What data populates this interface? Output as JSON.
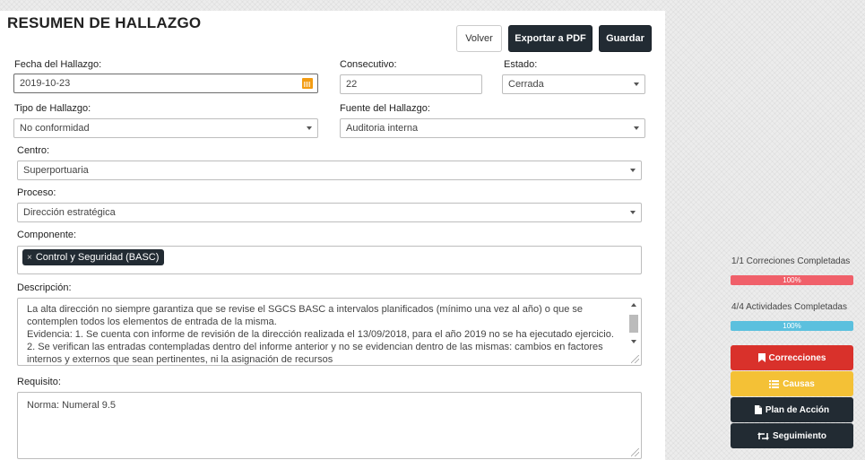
{
  "header": {
    "title": "RESUMEN DE HALLAZGO",
    "volver_label": "Volver",
    "pdf_label": "Exportar a PDF",
    "guardar_label": "Guardar"
  },
  "form": {
    "fecha": {
      "label": "Fecha del Hallazgo:",
      "value": "2019-10-23",
      "icon": "calendar-icon"
    },
    "consecutivo": {
      "label": "Consecutivo:",
      "value": "22"
    },
    "estado": {
      "label": "Estado:",
      "value": "Cerrada"
    },
    "tipo": {
      "label": "Tipo de Hallazgo:",
      "value": "No conformidad"
    },
    "fuente": {
      "label": "Fuente del Hallazgo:",
      "value": "Auditoria interna"
    },
    "centro": {
      "label": "Centro:",
      "value": "Superportuaria"
    },
    "proceso": {
      "label": "Proceso:",
      "value": "Dirección estratégica"
    },
    "componente": {
      "label": "Componente:",
      "tag_remove": "×",
      "tags": [
        "Control y Seguridad (BASC)"
      ]
    },
    "descripcion": {
      "label": "Descripción:",
      "value": "La alta dirección no siempre garantiza que se revise el SGCS BASC a intervalos planificados (mínimo una vez al año) o que se contemplen todos los elementos de entrada de la misma.\nEvidencia: 1. Se cuenta con informe de revisión de la dirección realizada el 13/09/2018, para el año 2019 no se ha ejecutado ejercicio.\n2. Se verifican las entradas contempladas dentro del informe anterior y no se evidencian dentro de las mismas: cambios en factores internos y externos que sean pertinentes, ni la asignación de recursos"
    },
    "requisito": {
      "label": "Requisito:",
      "value": "Norma: Numeral 9.5"
    }
  },
  "sidebar": {
    "correcciones_progress": {
      "label": "1/1 Correciones Completadas",
      "percent": 100,
      "text": "100%",
      "color": "#f0606a"
    },
    "actividades_progress": {
      "label": "4/4 Actividades Completadas",
      "percent": 100,
      "text": "100%",
      "color": "#5bc0de"
    },
    "buttons": [
      {
        "label": "Correcciones",
        "icon": "bookmark-icon",
        "color": "#d9312b"
      },
      {
        "label": "Causas",
        "icon": "list-icon",
        "color": "#f4c136"
      },
      {
        "label": "Plan de Acción",
        "icon": "file-icon",
        "color": "#222b33"
      },
      {
        "label": "Seguimiento",
        "icon": "retweet-icon",
        "color": "#222b33"
      }
    ]
  }
}
